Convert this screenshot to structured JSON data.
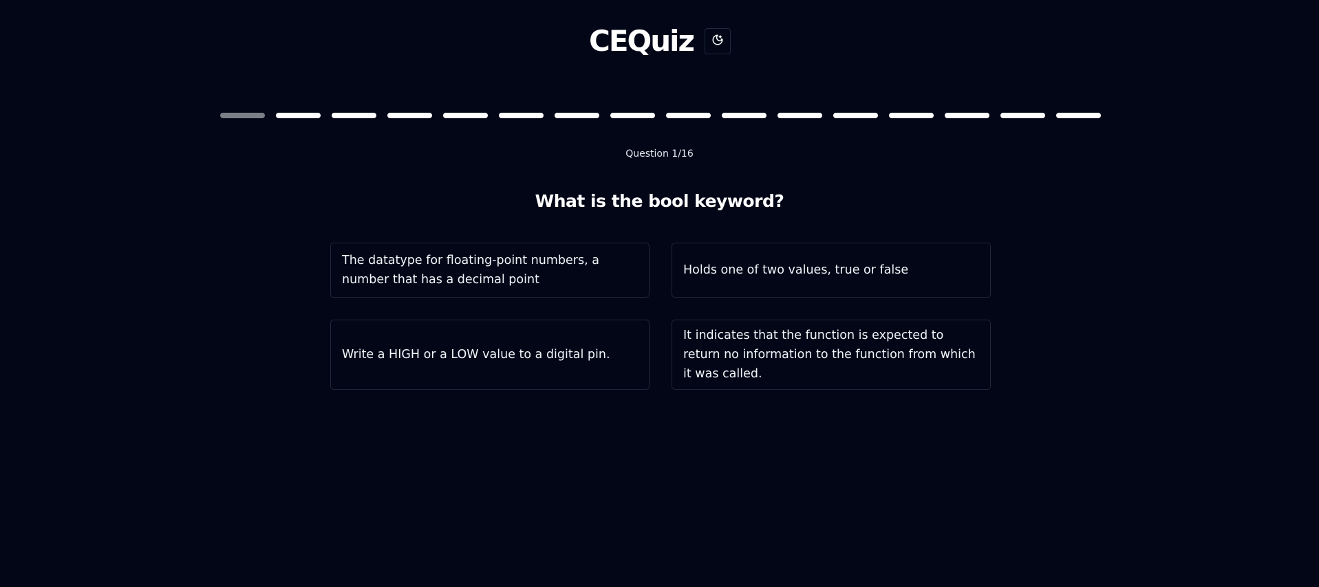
{
  "header": {
    "title": "CEQuiz",
    "theme_toggle_icon": "moon-stars-icon"
  },
  "progress": {
    "total": 16,
    "current": 1
  },
  "quiz": {
    "counter": "Question 1/16",
    "question": "What is the bool keyword?",
    "answers": [
      {
        "text": "The datatype for floating-point numbers, a number that has a decimal point"
      },
      {
        "text": "Holds one of two values, true or false"
      },
      {
        "text": "Write a HIGH or a LOW value to a digital pin."
      },
      {
        "text": "It indicates that the function is expected to return no information to the function from which it was called."
      }
    ]
  },
  "colors": {
    "background": "#020617",
    "text": "#ffffff",
    "progress_done": "#ffffff",
    "progress_current": "#7c7f86",
    "card_border": "#1f2937"
  }
}
